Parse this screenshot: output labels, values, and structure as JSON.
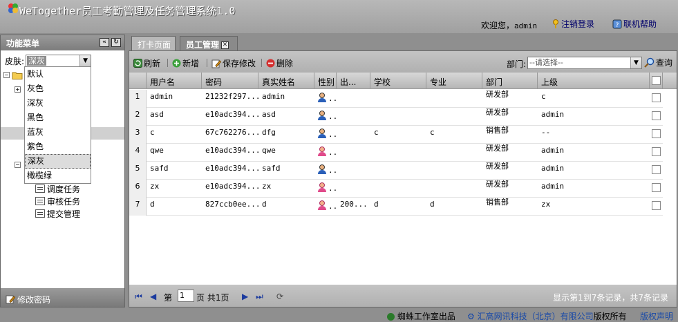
{
  "header": {
    "title": "WeTogether员工考勤管理及任务管理系统1.0",
    "welcome_text": "欢迎您，",
    "username": "admin",
    "logout_label": "注销登录",
    "help_label": "联机帮助"
  },
  "sidebar": {
    "title": "功能菜单",
    "skin_label": "皮肤:",
    "skin_value": "深灰",
    "skin_options": [
      "默认",
      "灰色",
      "深灰",
      "黑色",
      "蓝灰",
      "紫色",
      "深灰",
      "橄榄绿"
    ],
    "tree_items": [
      "调度任务",
      "审核任务",
      "提交管理"
    ],
    "change_password_label": "修改密码"
  },
  "tabs": [
    {
      "label": "打卡页面"
    },
    {
      "label": "员工管理"
    }
  ],
  "toolbar": {
    "refresh_label": "刷新",
    "add_label": "新增",
    "save_label": "保存修改",
    "delete_label": "删除",
    "dept_label": "部门:",
    "dept_placeholder": "--请选择--",
    "query_label": "查询"
  },
  "grid": {
    "columns": [
      "用户名",
      "密码",
      "真实姓名",
      "性别",
      "出...",
      "学校",
      "专业",
      "部门",
      "上级"
    ],
    "rows": [
      {
        "num": "1",
        "username": "admin",
        "password": "21232f297...",
        "realname": "admin",
        "gender": "male",
        "birth": "",
        "school": "",
        "major": "",
        "dept": "研发部",
        "superior": "c"
      },
      {
        "num": "2",
        "username": "asd",
        "password": "e10adc394...",
        "realname": "asd",
        "gender": "male",
        "birth": "",
        "school": "",
        "major": "",
        "dept": "研发部",
        "superior": "admin"
      },
      {
        "num": "3",
        "username": "c",
        "password": "67c762276...",
        "realname": "dfg",
        "gender": "male",
        "birth": "",
        "school": "c",
        "major": "c",
        "dept": "销售部",
        "superior": "--"
      },
      {
        "num": "4",
        "username": "qwe",
        "password": "e10adc394...",
        "realname": "qwe",
        "gender": "female",
        "birth": "",
        "school": "",
        "major": "",
        "dept": "研发部",
        "superior": "admin"
      },
      {
        "num": "5",
        "username": "safd",
        "password": "e10adc394...",
        "realname": "safd",
        "gender": "male",
        "birth": "",
        "school": "",
        "major": "",
        "dept": "研发部",
        "superior": "admin"
      },
      {
        "num": "6",
        "username": "zx",
        "password": "e10adc394...",
        "realname": "zx",
        "gender": "female",
        "birth": "",
        "school": "",
        "major": "",
        "dept": "研发部",
        "superior": "admin"
      },
      {
        "num": "7",
        "username": "d",
        "password": "827ccb0ee...",
        "realname": "d",
        "gender": "female",
        "birth": "200...",
        "school": "d",
        "major": "d",
        "dept": "销售部",
        "superior": "zx"
      }
    ]
  },
  "pager": {
    "page_prefix": "第",
    "page_value": "1",
    "page_suffix": "页 共",
    "total_pages": "1",
    "page_word": "页",
    "record_info": "显示第1到7条记录，共7条记录"
  },
  "footer": {
    "studio_label": "蜘蛛工作室出品",
    "company_label": "汇高网讯科技（北京）有限公司",
    "rights_label": "版权所有",
    "copyright_label": "版权声明"
  }
}
